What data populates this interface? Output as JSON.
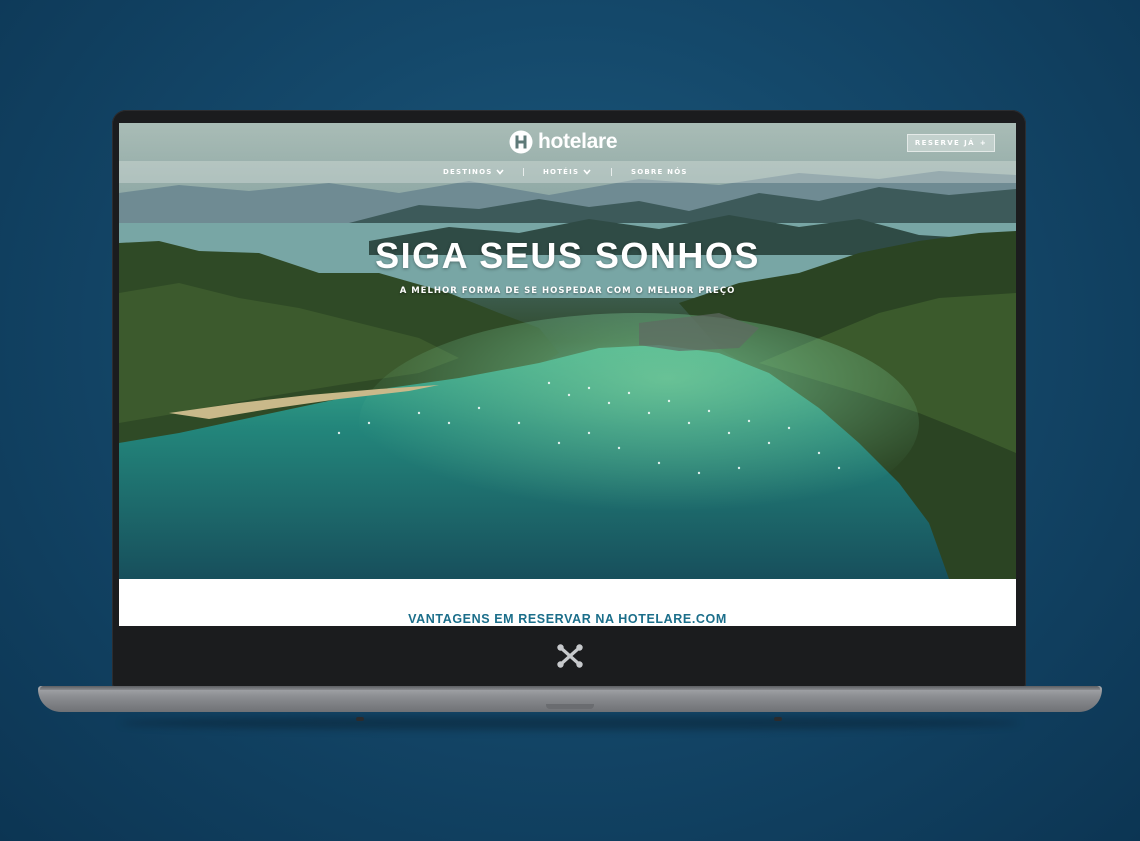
{
  "site": {
    "logo_text": "hotelare",
    "logo_icon": "hotelare-h-logo",
    "reserve_button": "RESERVE JÁ",
    "reserve_icon": "plus-icon"
  },
  "nav": {
    "items": [
      {
        "label": "DESTINOS",
        "icon": "chevron-down-icon"
      },
      {
        "label": "HOTÉIS",
        "icon": "chevron-down-icon"
      },
      {
        "label": "SOBRE NÓS"
      }
    ],
    "separator": "|"
  },
  "hero": {
    "headline": "SIGA SEUS SONHOS",
    "subheadline": "A MELHOR FORMA DE SE HOSPEDAR COM O MELHOR PREÇO"
  },
  "section": {
    "title": "VANTAGENS EM RESERVAR NA HOTELARE.COM"
  },
  "device": {
    "bezel_icon": "wrench-cross-icon"
  },
  "colors": {
    "background": "#14486a",
    "accent": "#1b6e8a",
    "bezel": "#1b1c1e"
  }
}
